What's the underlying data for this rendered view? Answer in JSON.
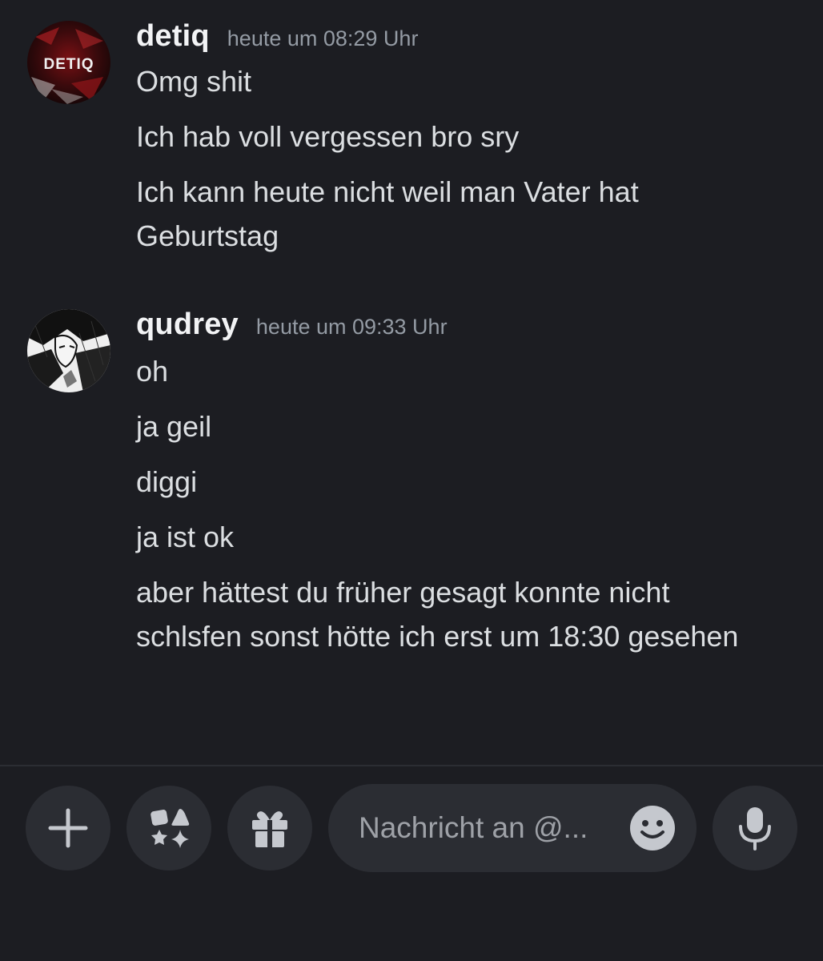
{
  "messages": [
    {
      "username": "detiq",
      "timestamp": "heute um 08:29 Uhr",
      "avatar_text": "DETIQ",
      "lines": [
        "Omg shit",
        "Ich hab voll vergessen bro sry",
        "Ich kann heute nicht weil man Vater hat Geburtstag"
      ]
    },
    {
      "username": "qudrey",
      "timestamp": "heute um 09:33 Uhr",
      "lines": [
        "oh",
        "ja geil",
        "diggi",
        "ja ist ok",
        "aber hättest du früher gesagt konnte nicht schlsfen sonst hötte ich erst um 18:30 gesehen"
      ]
    }
  ],
  "composer": {
    "placeholder": "Nachricht an @...",
    "buttons": [
      "plus-icon",
      "apps-icon",
      "gift-icon",
      "emoji-icon",
      "microphone-icon"
    ]
  },
  "colors": {
    "background": "#1c1d22",
    "surface": "#2b2d33",
    "text": "#dbdee1",
    "username": "#f2f3f5",
    "muted": "#949ba4",
    "icon": "#c5c8ce"
  }
}
